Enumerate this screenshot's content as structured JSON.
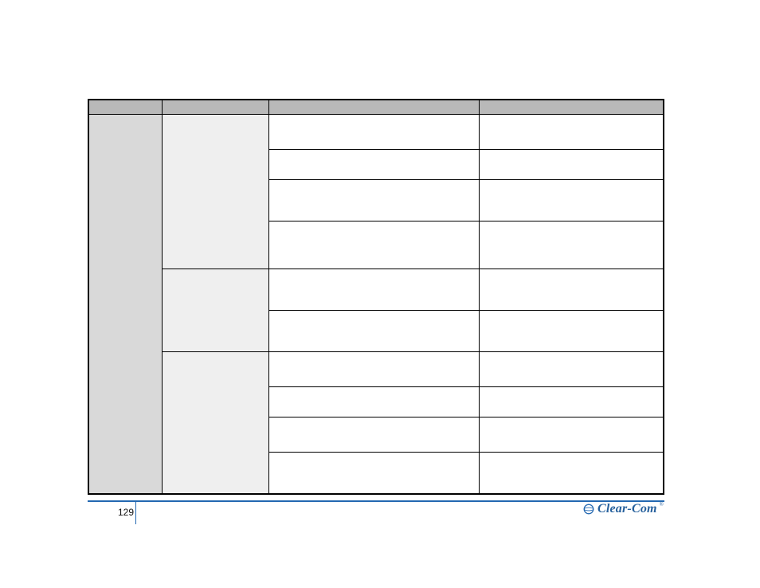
{
  "page": {
    "number": "129"
  },
  "brand": {
    "name": "Clear-Com",
    "tm": "®"
  },
  "table": {
    "headers": [
      "",
      "",
      "",
      ""
    ],
    "groups": [
      {
        "col0": "",
        "subgroups": [
          {
            "col1": "",
            "rows": [
              {
                "c2": "",
                "c3": "",
                "h": "h-44"
              },
              {
                "c2": "",
                "c3": "",
                "h": "h-38"
              },
              {
                "c2": "",
                "c3": "",
                "h": "h-52"
              },
              {
                "c2": "",
                "c3": "",
                "h": "h-60"
              }
            ]
          },
          {
            "col1": "",
            "rows": [
              {
                "c2": "",
                "c3": "",
                "h": "h-52"
              },
              {
                "c2": "",
                "c3": "",
                "h": "h-52"
              }
            ]
          },
          {
            "col1": "",
            "rows": [
              {
                "c2": "",
                "c3": "",
                "h": "h-44"
              },
              {
                "c2": "",
                "c3": "",
                "h": "h-38"
              },
              {
                "c2": "",
                "c3": "",
                "h": "h-44"
              },
              {
                "c2": "",
                "c3": "",
                "h": "h-52"
              }
            ]
          }
        ]
      }
    ]
  }
}
